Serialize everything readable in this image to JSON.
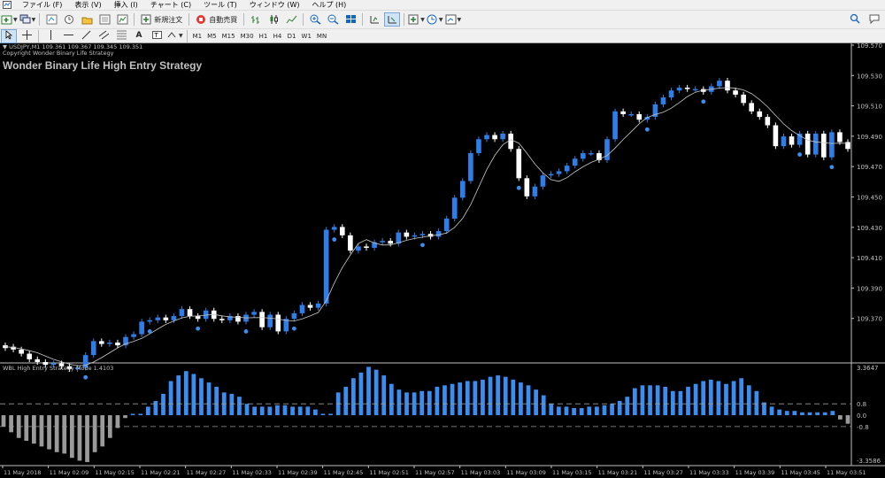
{
  "menu": [
    "ファイル (F)",
    "表示 (V)",
    "挿入 (I)",
    "チャート (C)",
    "ツール (T)",
    "ウィンドウ (W)",
    "ヘルプ (H)"
  ],
  "toolbar": {
    "new_order": "新規注文",
    "auto_trade": "自動売買",
    "timeframes": [
      "M1",
      "M5",
      "M15",
      "M30",
      "H1",
      "H4",
      "D1",
      "W1",
      "MN"
    ]
  },
  "chart": {
    "symbol_line": "USDJPY,M1  109.361 109.367 109.345 109.351",
    "copyright": "Copyright Wonder Binary Life Strategy",
    "strategy_title": "Wonder Binary Life High Entry Strategy",
    "price_labels": [
      "109.570",
      "109.530",
      "109.510",
      "109.490",
      "109.470",
      "109.450",
      "109.430",
      "109.410",
      "109.390",
      "109.370"
    ],
    "time_labels": [
      "11 May 2018",
      "11 May 02:09",
      "11 May 02:15",
      "11 May 02:21",
      "11 May 02:27",
      "11 May 02:33",
      "11 May 02:39",
      "11 May 02:45",
      "11 May 02:51",
      "11 May 02:57",
      "11 May 03:03",
      "11 May 03:09",
      "11 May 03:15",
      "11 May 03:21",
      "11 May 03:27",
      "11 May 03:33",
      "11 May 03:39",
      "11 May 03:45",
      "11 May 03:51"
    ],
    "colors": {
      "bull": "#2f7ee8",
      "bear": "#ffffff",
      "ma": "#c8c8c8",
      "dot": "#3a8ef0",
      "grid_text": "#c0c0c0",
      "hist_pos": "#3a8ef0",
      "hist_neg": "#9a9a9a"
    }
  },
  "indicator": {
    "title": "WBL High Entry Strategy Mode 1.4103",
    "scale_labels": [
      "3.3647",
      "0.8",
      "0.0",
      "-0.8",
      "-3.3586"
    ]
  },
  "chart_data": {
    "type": "candlestick",
    "price_ylim": [
      109.35,
      109.575
    ],
    "candles": [
      [
        109.362,
        109.36
      ],
      [
        109.361,
        109.359
      ],
      [
        109.359,
        109.356
      ],
      [
        109.356,
        109.352
      ],
      [
        109.352,
        109.35
      ],
      [
        109.35,
        109.348
      ],
      [
        109.348,
        109.349
      ],
      [
        109.349,
        109.347
      ],
      [
        109.347,
        109.345
      ],
      [
        109.345,
        109.346
      ],
      [
        109.346,
        109.355
      ],
      [
        109.355,
        109.365
      ],
      [
        109.365,
        109.363
      ],
      [
        109.363,
        109.364
      ],
      [
        109.364,
        109.362
      ],
      [
        109.362,
        109.368
      ],
      [
        109.368,
        109.37
      ],
      [
        109.37,
        109.379
      ],
      [
        109.379,
        109.38
      ],
      [
        109.38,
        109.382
      ],
      [
        109.382,
        109.38
      ],
      [
        109.38,
        109.383
      ],
      [
        109.383,
        109.388
      ],
      [
        109.388,
        109.383
      ],
      [
        109.383,
        109.381
      ],
      [
        109.381,
        109.387
      ],
      [
        109.387,
        109.381
      ],
      [
        109.381,
        109.38
      ],
      [
        109.38,
        109.383
      ],
      [
        109.383,
        109.379
      ],
      [
        109.379,
        109.384
      ],
      [
        109.384,
        109.386
      ],
      [
        109.386,
        109.375
      ],
      [
        109.375,
        109.384
      ],
      [
        109.384,
        109.372
      ],
      [
        109.372,
        109.381
      ],
      [
        109.381,
        109.385
      ],
      [
        109.385,
        109.391
      ],
      [
        109.391,
        109.389
      ],
      [
        109.389,
        109.392
      ],
      [
        109.392,
        109.445
      ],
      [
        109.445,
        109.447
      ],
      [
        109.447,
        109.441
      ],
      [
        109.441,
        109.43
      ],
      [
        109.43,
        109.433
      ],
      [
        109.433,
        109.432
      ],
      [
        109.432,
        109.436
      ],
      [
        109.436,
        109.437
      ],
      [
        109.437,
        109.435
      ],
      [
        109.435,
        109.443
      ],
      [
        109.443,
        109.44
      ],
      [
        109.44,
        109.441
      ],
      [
        109.441,
        109.442
      ],
      [
        109.442,
        109.44
      ],
      [
        109.44,
        109.444
      ],
      [
        109.444,
        109.453
      ],
      [
        109.453,
        109.468
      ],
      [
        109.468,
        109.48
      ],
      [
        109.48,
        109.5
      ],
      [
        109.5,
        109.51
      ],
      [
        109.51,
        109.513
      ],
      [
        109.513,
        109.51
      ],
      [
        109.51,
        109.514
      ],
      [
        109.514,
        109.503
      ],
      [
        109.503,
        109.482
      ],
      [
        109.482,
        109.469
      ],
      [
        109.469,
        109.476
      ],
      [
        109.476,
        109.484
      ],
      [
        109.484,
        109.485
      ],
      [
        109.485,
        109.487
      ],
      [
        109.487,
        109.491
      ],
      [
        109.491,
        109.496
      ],
      [
        109.496,
        109.5
      ],
      [
        109.5,
        109.5
      ],
      [
        109.5,
        109.495
      ],
      [
        109.495,
        109.51
      ],
      [
        109.51,
        109.53
      ],
      [
        109.53,
        109.528
      ],
      [
        109.528,
        109.528
      ],
      [
        109.528,
        109.524
      ],
      [
        109.524,
        109.526
      ],
      [
        109.526,
        109.535
      ],
      [
        109.535,
        109.54
      ],
      [
        109.54,
        109.545
      ],
      [
        109.545,
        109.547
      ],
      [
        109.547,
        109.546
      ],
      [
        109.546,
        109.546
      ],
      [
        109.546,
        109.544
      ],
      [
        109.544,
        109.548
      ],
      [
        109.548,
        109.552
      ],
      [
        109.552,
        109.545
      ],
      [
        109.545,
        109.542
      ],
      [
        109.542,
        109.536
      ],
      [
        109.536,
        109.53
      ],
      [
        109.53,
        109.526
      ],
      [
        109.526,
        109.52
      ],
      [
        109.52,
        109.505
      ],
      [
        109.505,
        109.512
      ],
      [
        109.512,
        109.506
      ],
      [
        109.506,
        109.514
      ],
      [
        109.514,
        109.499
      ],
      [
        109.499,
        109.514
      ],
      [
        109.514,
        109.497
      ],
      [
        109.497,
        109.515
      ],
      [
        109.515,
        109.508
      ],
      [
        109.508,
        109.503
      ]
    ],
    "histogram": [
      -0.8,
      -1.2,
      -1.6,
      -1.8,
      -2.0,
      -2.2,
      -2.4,
      -2.6,
      -2.7,
      -3.0,
      -3.2,
      -3.3,
      -2.6,
      -2.2,
      -1.6,
      -0.9,
      -0.2,
      0.1,
      0.1,
      0.6,
      1.0,
      1.5,
      2.4,
      2.8,
      3.1,
      2.9,
      2.6,
      2.3,
      2.0,
      1.6,
      1.5,
      1.3,
      0.8,
      0.6,
      0.6,
      0.6,
      0.7,
      0.7,
      0.6,
      0.6,
      0.6,
      0.4,
      0.1,
      0.1,
      1.6,
      2.0,
      2.6,
      3.0,
      3.4,
      3.2,
      2.8,
      2.2,
      1.8,
      1.6,
      1.6,
      1.7,
      1.7,
      2.0,
      2.1,
      2.2,
      2.3,
      2.4,
      2.4,
      2.5,
      2.7,
      2.8,
      2.7,
      2.5,
      2.3,
      2.1,
      1.8,
      1.4,
      0.8,
      0.6,
      0.6,
      0.5,
      0.5,
      0.6,
      0.6,
      0.7,
      0.8,
      1.0,
      1.3,
      1.9,
      2.1,
      2.1,
      2.1,
      2.0,
      1.7,
      1.7,
      2.0,
      2.2,
      2.4,
      2.5,
      2.4,
      2.2,
      2.4,
      2.6,
      2.1,
      1.7,
      0.9,
      0.6,
      0.4,
      0.3,
      0.3,
      0.2,
      0.2,
      0.2,
      0.2,
      0.3,
      -0.3,
      -0.6
    ],
    "hist_ylim": [
      -3.3586,
      3.3647
    ]
  }
}
